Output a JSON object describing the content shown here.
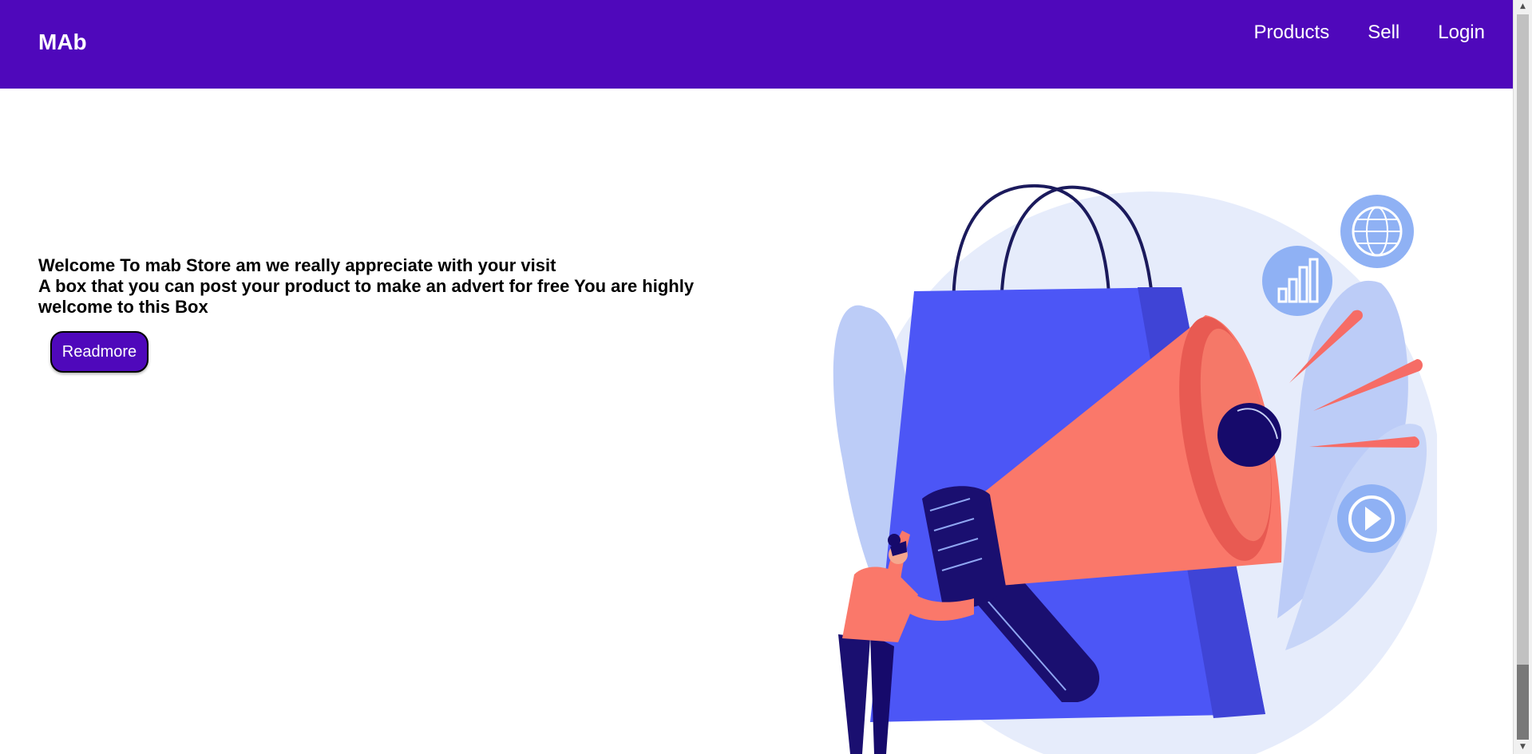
{
  "nav": {
    "brand": "MAb",
    "links": [
      {
        "label": "Products"
      },
      {
        "label": "Sell"
      },
      {
        "label": "Login"
      }
    ]
  },
  "hero": {
    "line1": "Welcome To mab Store am we really appreciate with your visit",
    "line2": "A box that you can post your product to make an advert for free You are highly welcome to this Box",
    "button_label": "Readmore"
  },
  "illustration": {
    "subject": "person-with-megaphone-and-shopping-bag",
    "icons": [
      "globe-icon",
      "bar-chart-icon",
      "play-icon"
    ]
  },
  "colors": {
    "brand": "#4f08bb",
    "bag": "#4c56f6",
    "megaphone": "#fa786a",
    "bubble": "#8fb1f4",
    "navy": "#160a6b"
  }
}
